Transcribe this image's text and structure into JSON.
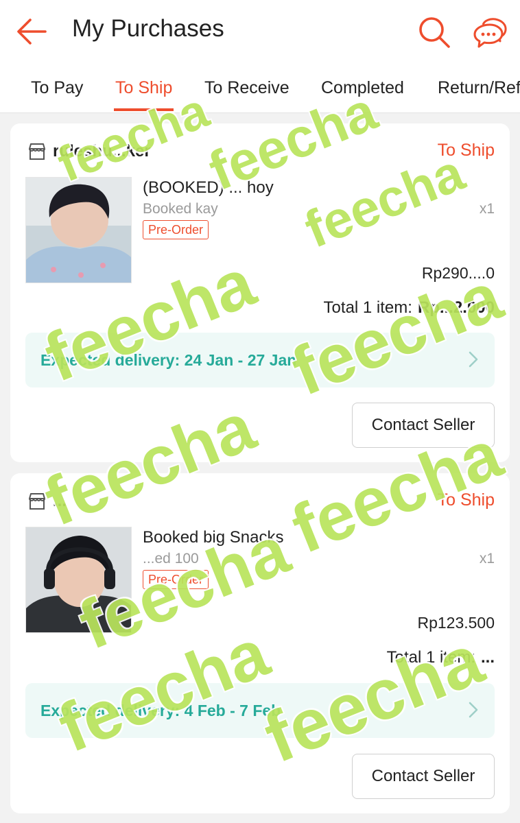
{
  "header": {
    "title": "My Purchases",
    "back_icon": "arrow-left-icon",
    "search_icon": "search-icon",
    "chat_icon": "chat-icon",
    "accent_color": "#ee4d2d"
  },
  "tabs": [
    {
      "label": "To Pay",
      "active": false
    },
    {
      "label": "To Ship",
      "active": true
    },
    {
      "label": "To Receive",
      "active": false
    },
    {
      "label": "Completed",
      "active": false
    },
    {
      "label": "Return/Ref",
      "active": false
    }
  ],
  "orders": [
    {
      "shop_name": "ruleshu...ker",
      "status": "To Ship",
      "product_name": "(BOOKED) ... hoy",
      "variant": "Booked kay",
      "quantity": "x1",
      "badge": "Pre-Order",
      "price": "Rp290....0",
      "total_label": "Total 1 item:",
      "total_amount": "Rp...2.000",
      "delivery": "Expected delivery: 24 Jan - 27 Jan",
      "contact_label": "Contact Seller"
    },
    {
      "shop_name": "...",
      "status": "To Ship",
      "product_name": "Booked big Snacks",
      "variant": "...ed 100",
      "quantity": "x1",
      "badge": "Pre-Order",
      "price": "Rp123.500",
      "total_label": "Total 1 item:",
      "total_amount": "...",
      "delivery": "Expected delivery: 4 Feb - 7 Feb",
      "contact_label": "Contact Seller"
    }
  ],
  "watermark": "feecha"
}
